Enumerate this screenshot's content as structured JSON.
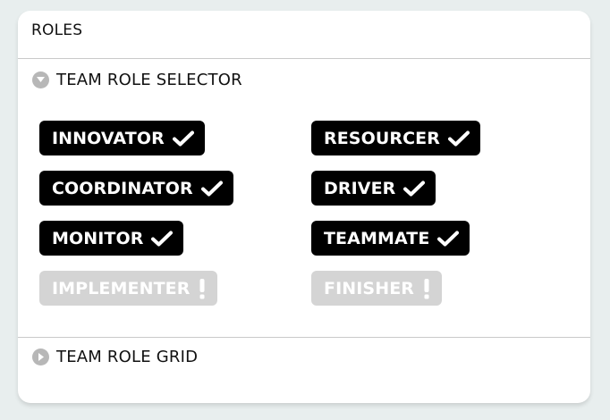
{
  "card": {
    "title": "ROLES"
  },
  "selector": {
    "title": "TEAM ROLE SELECTOR",
    "expanded": true,
    "roles": [
      {
        "label": "INNOVATOR",
        "selected": true,
        "status_icon": "check-icon"
      },
      {
        "label": "RESOURCER",
        "selected": true,
        "status_icon": "check-icon"
      },
      {
        "label": "COORDINATOR",
        "selected": true,
        "status_icon": "check-icon"
      },
      {
        "label": "DRIVER",
        "selected": true,
        "status_icon": "check-icon"
      },
      {
        "label": "MONITOR",
        "selected": true,
        "status_icon": "check-icon"
      },
      {
        "label": "TEAMMATE",
        "selected": true,
        "status_icon": "check-icon"
      },
      {
        "label": "IMPLEMENTER",
        "selected": false,
        "status_icon": "exclamation-icon"
      },
      {
        "label": "FINISHER",
        "selected": false,
        "status_icon": "exclamation-icon"
      }
    ]
  },
  "grid": {
    "title": "TEAM ROLE GRID",
    "expanded": false
  },
  "colors": {
    "page_background": "#e8eeee",
    "card_background": "#ffffff",
    "selected_badge": "#000000",
    "unselected_badge": "#d4d4d4",
    "toggle_icon": "#b7b7b7"
  }
}
